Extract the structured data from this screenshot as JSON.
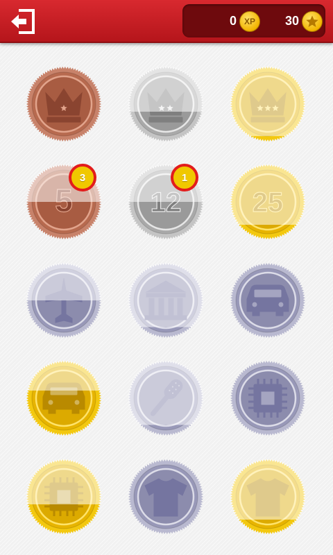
{
  "header": {
    "back_icon": "exit-arrow-icon",
    "xp_value": "0",
    "xp_label": "XP",
    "stars_value": "30",
    "star_icon": "star-icon"
  },
  "medals": [
    {
      "id": "crown-one-star",
      "metal": "bronze",
      "icon": "crown-icon",
      "stars": 1,
      "unlocked": true,
      "progress": 1.0
    },
    {
      "id": "crown-two-stars",
      "metal": "silver",
      "icon": "crown-icon",
      "stars": 2,
      "unlocked": false,
      "progress": 0.4
    },
    {
      "id": "crown-three-stars",
      "metal": "gold",
      "icon": "crown-icon",
      "stars": 3,
      "unlocked": false,
      "progress": 0.08
    },
    {
      "id": "levels-5",
      "metal": "bronze",
      "icon": "number",
      "number": "5",
      "unlocked": false,
      "progress": 0.5,
      "badge": "3"
    },
    {
      "id": "levels-12",
      "metal": "silver",
      "icon": "number",
      "number": "12",
      "unlocked": false,
      "progress": 0.5,
      "badge": "1"
    },
    {
      "id": "levels-25",
      "metal": "gold",
      "icon": "number",
      "number": "25",
      "unlocked": false,
      "progress": 0.2
    },
    {
      "id": "travel-plane",
      "metal": "lavender",
      "icon": "airplane-icon",
      "unlocked": false,
      "progress": 0.5
    },
    {
      "id": "bank",
      "metal": "lavender",
      "icon": "bank-icon",
      "unlocked": false,
      "progress": 0.15
    },
    {
      "id": "car-silver",
      "metal": "lavender",
      "icon": "car-icon",
      "unlocked": true,
      "progress": 1.0
    },
    {
      "id": "car-gold",
      "metal": "gold",
      "icon": "car-icon",
      "unlocked": false,
      "progress": 0.6
    },
    {
      "id": "hairbrush",
      "metal": "lavender",
      "icon": "hairbrush-icon",
      "unlocked": false,
      "progress": 0.15
    },
    {
      "id": "chip-silver",
      "metal": "lavender",
      "icon": "chip-icon",
      "unlocked": true,
      "progress": 1.0
    },
    {
      "id": "chip-gold",
      "metal": "gold",
      "icon": "chip-icon",
      "unlocked": false,
      "progress": 0.4
    },
    {
      "id": "shirt-silver",
      "metal": "lavender",
      "icon": "shirt-icon",
      "unlocked": true,
      "progress": 1.0
    },
    {
      "id": "shirt-gold",
      "metal": "gold",
      "icon": "shirt-icon",
      "unlocked": false,
      "progress": 0.2
    }
  ],
  "colors": {
    "header_red": "#c61c22",
    "panel_dark": "#6e0a0d",
    "badge_fill": "#f0c800",
    "badge_ring": "#e21c1c"
  }
}
